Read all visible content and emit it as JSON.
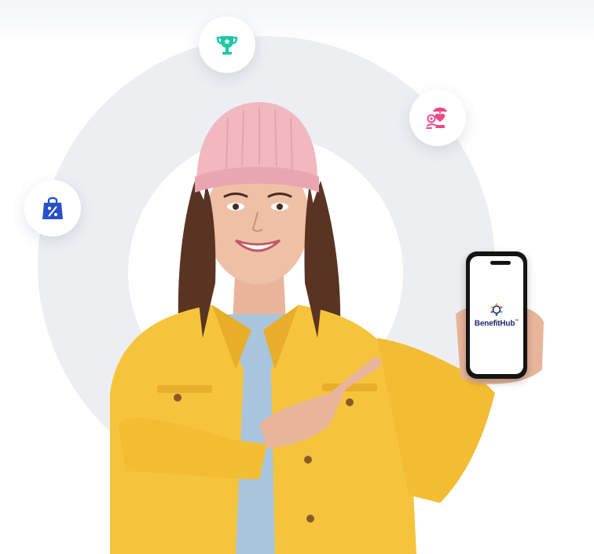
{
  "brand": {
    "name": "BenefitHub",
    "trademark": "™"
  },
  "icons": {
    "top": "trophy-icon",
    "right": "care-heart-umbrella-icon",
    "left": "shopping-bag-percent-icon"
  },
  "colors": {
    "background": "#ffffff",
    "ring": "#eceef2",
    "trophy": "#1ec8a5",
    "care": "#e94c8a",
    "bag": "#2851c9",
    "jacket": "#f6c43c",
    "beanie": "#f1b8c0",
    "brand_text": "#1b2a6b"
  }
}
